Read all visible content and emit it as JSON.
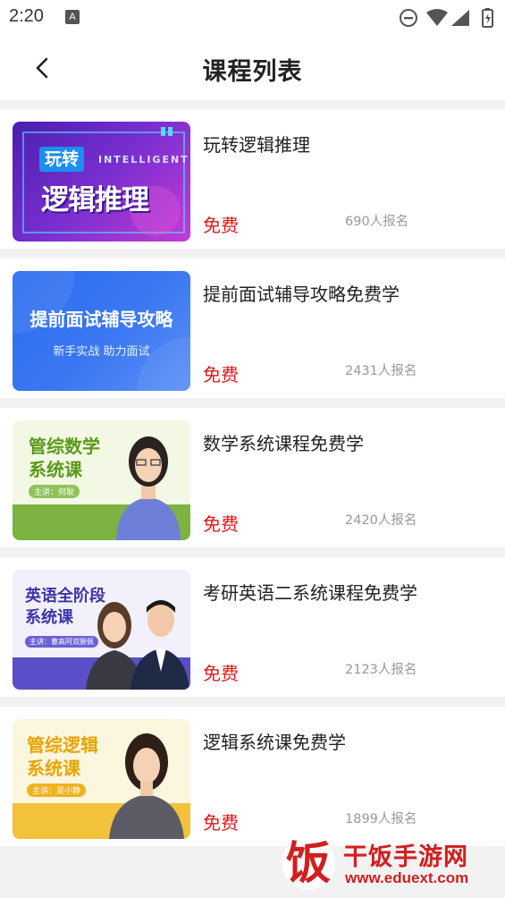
{
  "status_bar": {
    "time": "2:20",
    "notification_icon": "A",
    "icons": [
      "do-not-disturb-icon",
      "wifi-icon",
      "signal-icon",
      "battery-icon"
    ]
  },
  "header": {
    "title": "课程列表",
    "back_icon": "chevron-left-icon"
  },
  "colors": {
    "price_red": "#e0191b",
    "count_gray": "#999999",
    "background": "#f2f2f2"
  },
  "courses": [
    {
      "title": "玩转逻辑推理",
      "price": "免费",
      "enrolled": "690人报名",
      "thumb": {
        "line1": "玩转",
        "line2": "逻辑推理",
        "badge_en": "INTELLIGENT"
      }
    },
    {
      "title": "提前面试辅导攻略免费学",
      "price": "免费",
      "enrolled": "2431人报名",
      "thumb": {
        "line1": "提前面试辅导攻略",
        "line2": "新手实战   助力面试"
      }
    },
    {
      "title": "数学系统课程免费学",
      "price": "免费",
      "enrolled": "2420人报名",
      "thumb": {
        "line1": "管综数学",
        "line2": "系统课",
        "tag": "主讲：何耿"
      }
    },
    {
      "title": "考研英语二系统课程免费学",
      "price": "免费",
      "enrolled": "2123人报名",
      "thumb": {
        "line1": "英语全阶段",
        "line2": "系统课",
        "tag": "主讲：曹高阿双腿佩"
      }
    },
    {
      "title": "逻辑系统课免费学",
      "price": "免费",
      "enrolled": "1899人报名",
      "thumb": {
        "line1": "管综逻辑",
        "line2": "系统课",
        "tag": "主讲：吴小静"
      }
    }
  ],
  "watermark": {
    "logo_char": "饭",
    "name": "干饭手游网",
    "url": "www.eduext.com"
  }
}
